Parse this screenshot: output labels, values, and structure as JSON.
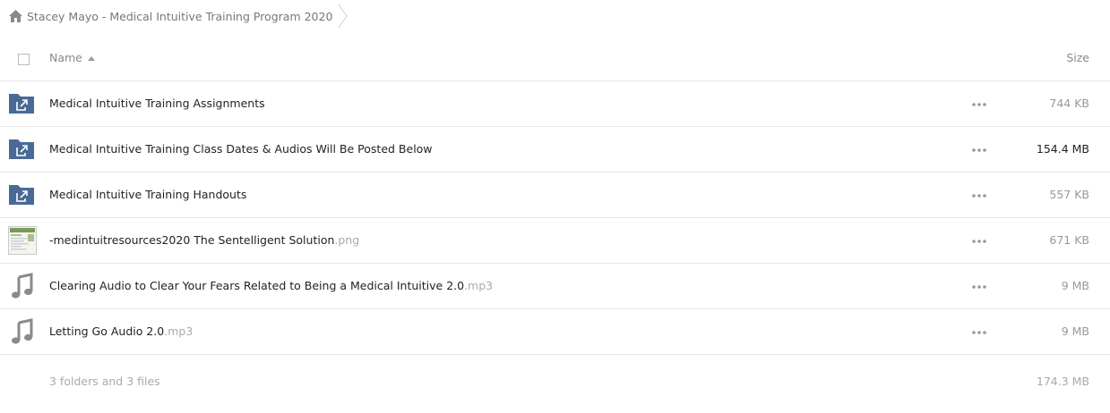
{
  "breadcrumb": {
    "home_icon": "home-icon",
    "label": "Stacey Mayo - Medical Intuitive Training Program 2020"
  },
  "header": {
    "name_label": "Name",
    "sort_icon": "sort-ascending-icon",
    "size_label": "Size"
  },
  "colors": {
    "folder": "#4a6a96",
    "audio_icon": "#8a8a8a",
    "text": "#222222",
    "muted": "#999999"
  },
  "files": [
    {
      "type": "shared-folder",
      "icon": "shared-folder-icon",
      "name": "Medical Intuitive Training Assignments",
      "ext": "",
      "size": "744 KB"
    },
    {
      "type": "shared-folder",
      "icon": "shared-folder-icon",
      "name": "Medical Intuitive Training Class Dates & Audios Will Be Posted Below",
      "ext": "",
      "size": "154.4 MB"
    },
    {
      "type": "shared-folder",
      "icon": "shared-folder-icon",
      "name": "Medical Intuitive Training Handouts",
      "ext": "",
      "size": "557 KB"
    },
    {
      "type": "image",
      "icon": "image-thumbnail-icon",
      "name": "-medintuitresources2020 The Sentelligent Solution",
      "ext": ".png",
      "size": "671 KB"
    },
    {
      "type": "audio",
      "icon": "music-note-icon",
      "name": "Clearing Audio to Clear Your Fears Related to Being a Medical Intuitive 2.0",
      "ext": ".mp3",
      "size": "9 MB"
    },
    {
      "type": "audio",
      "icon": "music-note-icon",
      "name": "Letting Go Audio 2.0",
      "ext": ".mp3",
      "size": "9 MB"
    }
  ],
  "footer": {
    "summary": "3 folders and 3 files",
    "total": "174.3 MB"
  }
}
